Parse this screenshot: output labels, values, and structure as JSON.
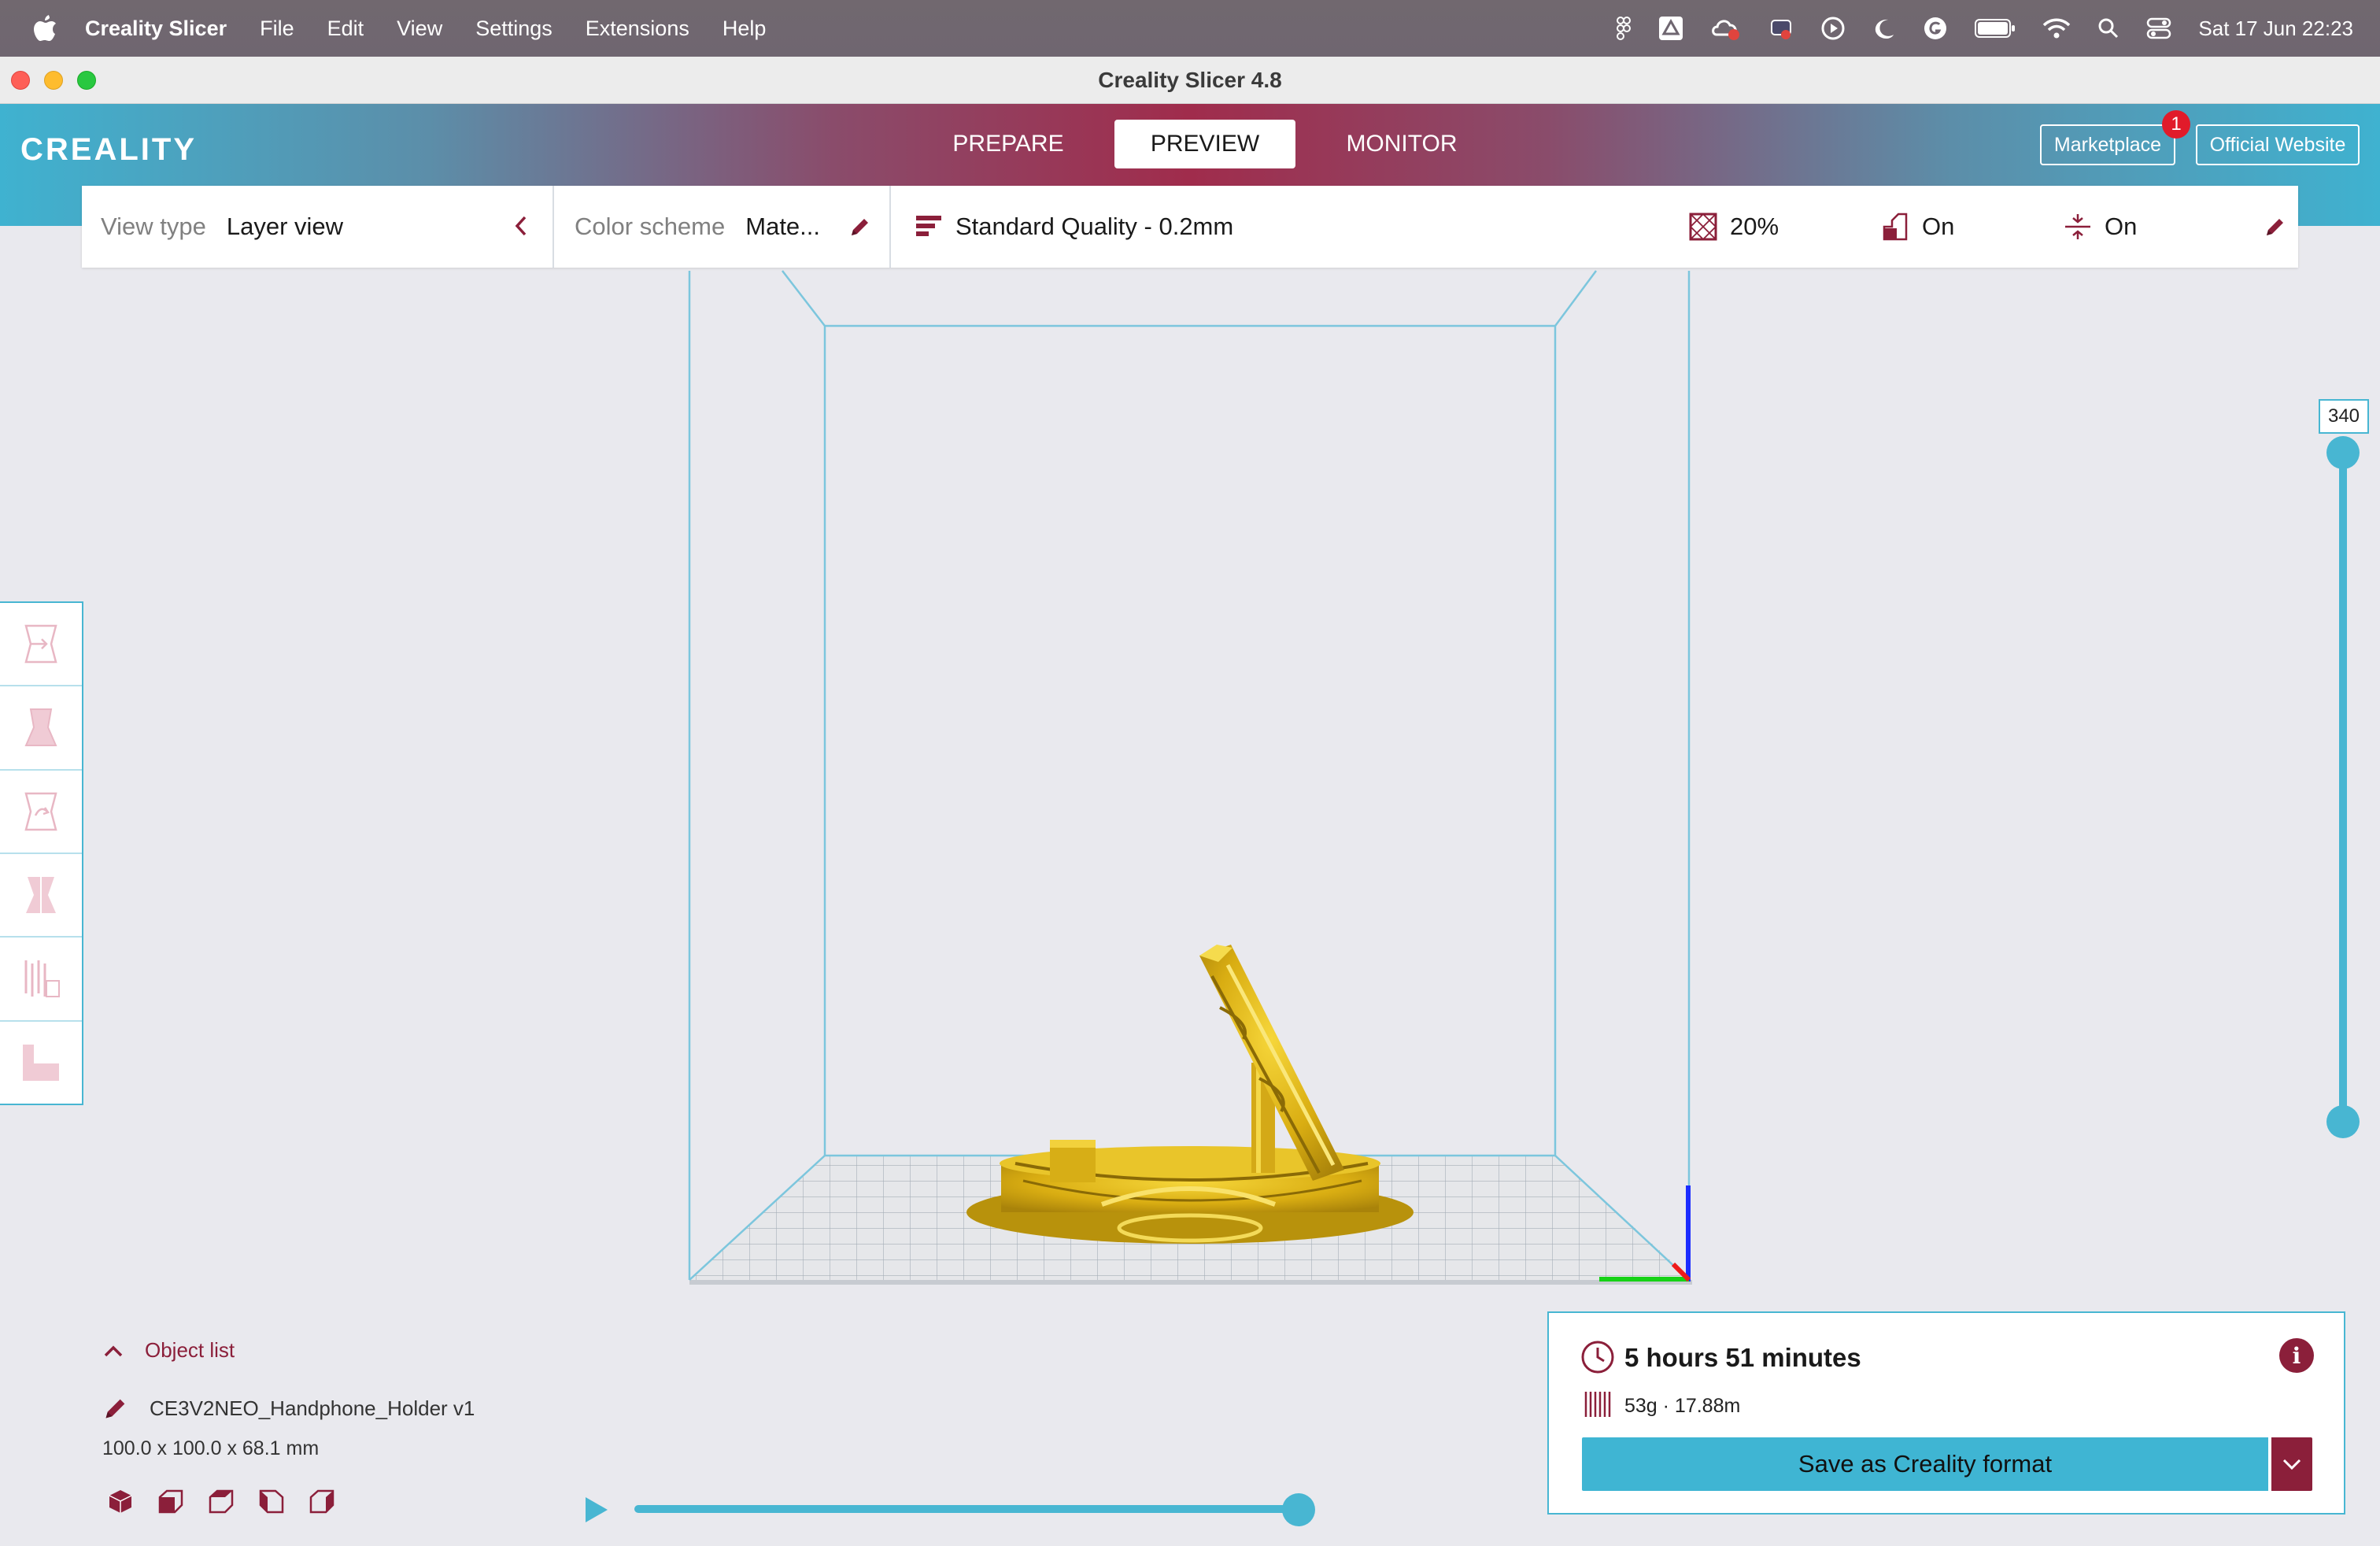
{
  "menubar": {
    "app_name": "Creality Slicer",
    "items": [
      "File",
      "Edit",
      "View",
      "Settings",
      "Extensions",
      "Help"
    ],
    "clock": "Sat 17 Jun  22:23"
  },
  "window": {
    "title": "Creality Slicer 4.8"
  },
  "header": {
    "logo": "CREALITY",
    "tabs": [
      {
        "label": "PREPARE",
        "active": false
      },
      {
        "label": "PREVIEW",
        "active": true
      },
      {
        "label": "MONITOR",
        "active": false
      }
    ],
    "marketplace_label": "Marketplace",
    "marketplace_badge": "1",
    "official_website_label": "Official Website"
  },
  "settings": {
    "view_type_label": "View type",
    "view_type_value": "Layer view",
    "color_scheme_label": "Color scheme",
    "color_scheme_value": "Mate...",
    "profile": "Standard Quality - 0.2mm",
    "infill": "20%",
    "support": "On",
    "adhesion": "On"
  },
  "layer_slider": {
    "current_layer": "340",
    "upper_fraction": 1.0,
    "lower_fraction": 0.0
  },
  "object_list": {
    "header": "Object list",
    "object_name": "CE3V2NEO_Handphone_Holder v1",
    "dimensions": "100.0 x 100.0 x 68.1 mm"
  },
  "playback": {
    "progress_fraction": 1.0
  },
  "print_info": {
    "time": "5 hours 51 minutes",
    "material": "53g · 17.88m",
    "save_label": "Save as Creality format"
  },
  "colors": {
    "accent_blue": "#48b6d2",
    "brand_maroon": "#8b1f3a",
    "model_yellow": "#e8c21a"
  }
}
